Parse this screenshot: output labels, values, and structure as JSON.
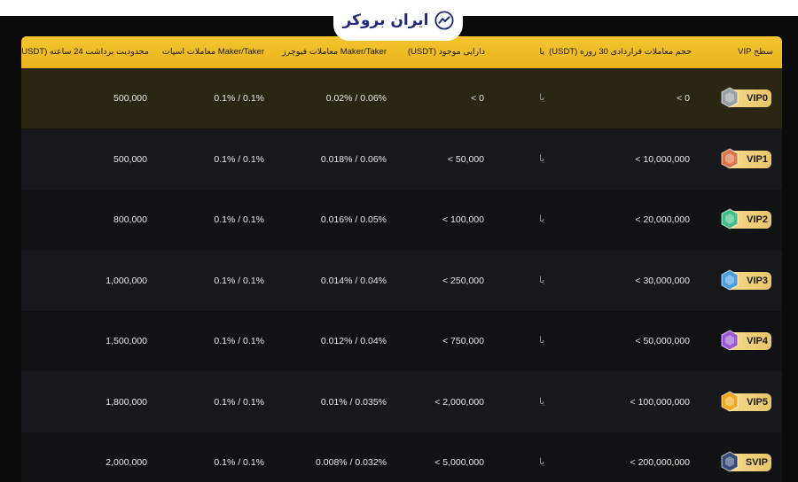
{
  "brand": {
    "name": "ایران بروکر",
    "accent": "#f0b90b",
    "logo_color": "#1e2a78"
  },
  "headers": {
    "vip_level": "سطح VIP",
    "volume_30d": "حجم معاملات قراردادی 30 روزه (USDT)",
    "and": "یا",
    "assets": "دارایی موجود (USDT)",
    "futures_fee": "Maker/Taker معاملات فیوچرز",
    "spot_fee": "Maker/Taker معاملات اسپات",
    "withdraw_limit": "محدودیت برداشت 24 ساعته (USDT)"
  },
  "rows": [
    {
      "level": "VIP0",
      "gem_color": "#9aa0a6",
      "volume": "< 0",
      "and": "یا",
      "assets": "< 0",
      "futures": "0.02% / 0.06%",
      "spot": "0.1% / 0.1%",
      "withdraw": "500,000"
    },
    {
      "level": "VIP1",
      "gem_color": "#d9764a",
      "volume": "< 10,000,000",
      "and": "یا",
      "assets": "< 50,000",
      "futures": "0.018% / 0.06%",
      "spot": "0.1% / 0.1%",
      "withdraw": "500,000"
    },
    {
      "level": "VIP2",
      "gem_color": "#3fbf8a",
      "volume": "< 20,000,000",
      "and": "یا",
      "assets": "< 100,000",
      "futures": "0.016% / 0.05%",
      "spot": "0.1% / 0.1%",
      "withdraw": "800,000"
    },
    {
      "level": "VIP3",
      "gem_color": "#4a9ee0",
      "volume": "< 30,000,000",
      "and": "یا",
      "assets": "< 250,000",
      "futures": "0.014% / 0.04%",
      "spot": "0.1% / 0.1%",
      "withdraw": "1,000,000"
    },
    {
      "level": "VIP4",
      "gem_color": "#9b59d6",
      "volume": "< 50,000,000",
      "and": "یا",
      "assets": "< 750,000",
      "futures": "0.012% / 0.04%",
      "spot": "0.1% / 0.1%",
      "withdraw": "1,500,000"
    },
    {
      "level": "VIP5",
      "gem_color": "#f0a81c",
      "volume": "< 100,000,000",
      "and": "یا",
      "assets": "< 2,000,000",
      "futures": "0.01% / 0.035%",
      "spot": "0.1% / 0.1%",
      "withdraw": "1,800,000"
    },
    {
      "level": "SVIP",
      "gem_color": "#3a4a78",
      "volume": "< 200,000,000",
      "and": "یا",
      "assets": "< 5,000,000",
      "futures": "0.008% / 0.032%",
      "spot": "0.1% / 0.1%",
      "withdraw": "2,000,000"
    }
  ]
}
